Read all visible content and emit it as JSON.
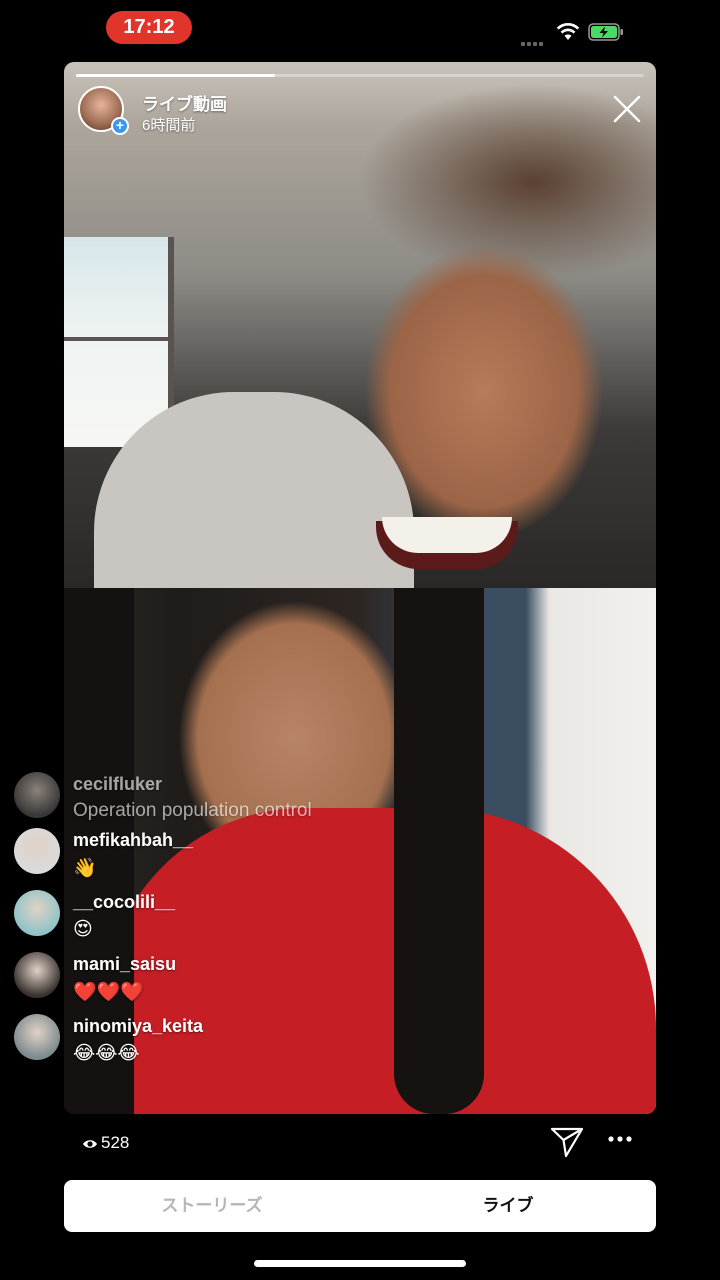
{
  "status_bar": {
    "time": "17:12",
    "time_pill_color": "#e0352b",
    "battery_state": "charging",
    "battery_color": "#4cd964"
  },
  "broadcast": {
    "title": "ライブ動画",
    "time_ago": "6時間前",
    "progress_fraction": 0.35,
    "close_icon": "close-icon",
    "viewer_count": "528"
  },
  "comments": [
    {
      "username": "cecilfluker",
      "text": "Operation population control",
      "faded": true,
      "avatar_color": "#5c5a58"
    },
    {
      "username": "mefikahbah__",
      "text": "👋",
      "faded": false,
      "avatar_color": "#d9dadc"
    },
    {
      "username": "__cocolili__",
      "text": "😍",
      "faded": false,
      "avatar_color": "#8fc3c8"
    },
    {
      "username": "mami_saisu",
      "text": "❤️❤️❤️",
      "faded": false,
      "avatar_color": "#3a3230"
    },
    {
      "username": "ninomiya_keita",
      "text": "😂😂😂",
      "faded": false,
      "avatar_color": "#7d8a8e"
    }
  ],
  "tabs": {
    "stories": "ストーリーズ",
    "live": "ライブ",
    "active": "live"
  }
}
